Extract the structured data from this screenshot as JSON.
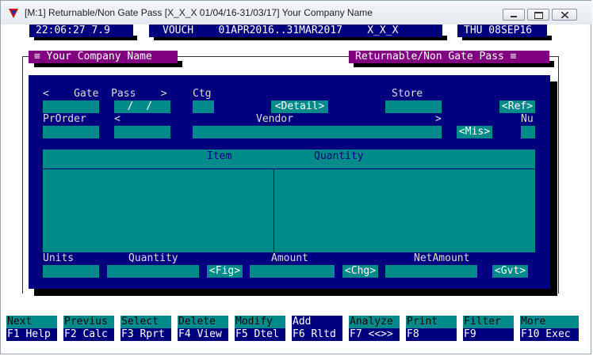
{
  "window": {
    "title": "[M:1]  Returnable/Non Gate Pass  [X_X_X  01/04/16-31/03/17]  Your Company Name"
  },
  "statusbar": {
    "time": "22:06:27 7.9",
    "voucher": "VOUCH    01APR2016..31MAR2017    X_X_X",
    "date": "THU 08SEP16"
  },
  "menus": {
    "left": "≡ Your Company Name",
    "right": "Returnable/Non Gate Pass ≡"
  },
  "form": {
    "gate_pass_label": "<    Gate  Pass    >",
    "gate_pass_date": "  /  /",
    "ctg_label": "Ctg",
    "detail_button": "<Detail>",
    "store_label": "Store",
    "ref_button": "<Ref>",
    "prorder_label": "PrOrder",
    "vendor_open": "<",
    "vendor_label": "Vendor",
    "vendor_close": ">",
    "mis_button": "<Mis>",
    "nu_label": "Nu",
    "grid_item_header": "Item",
    "grid_quantity_header": "Quantity",
    "units_label": "Units",
    "quantity_label": "Quantity",
    "amount_label": "Amount",
    "netamount_label": "NetAmount",
    "fig_button": "<Fig>",
    "chg_button": "<Chg>",
    "gvt_button": "<Gvt>"
  },
  "fkeys": [
    {
      "top": "Next",
      "bottom": "F1 Help"
    },
    {
      "top": "Previus",
      "bottom": "F2 Calc"
    },
    {
      "top": "Select",
      "bottom": "F3 Rprt"
    },
    {
      "top": "Delete",
      "bottom": "F4 View"
    },
    {
      "top": "Modify",
      "bottom": "F5 Dtel"
    },
    {
      "top": "Add",
      "bottom": "F6 Rltd"
    },
    {
      "top": "Analyze",
      "bottom": "F7 <<>>"
    },
    {
      "top": "Print",
      "bottom": "F8"
    },
    {
      "top": "Filter",
      "bottom": "F9"
    },
    {
      "top": "More",
      "bottom": "F10 Exec"
    }
  ],
  "colors": {
    "dos_blue": "#00007f",
    "cyan": "#008a8a",
    "magenta": "#800080"
  }
}
